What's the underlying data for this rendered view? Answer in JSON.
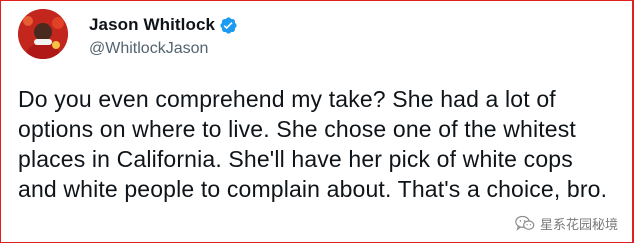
{
  "tweet": {
    "author_name": "Jason Whitlock",
    "author_handle": "@WhitlockJason",
    "verified_icon": "verified-badge-icon",
    "text": "Do you even comprehend my take? She had a lot of options on where to live. She chose one of the whitest places in California. She'll have her pick of white cops and white people to complain about. That's a choice, bro."
  },
  "watermark": {
    "icon": "wechat-icon",
    "text": "星系花园秘境"
  },
  "colors": {
    "frame_border": "#e02020",
    "verified_blue": "#1d9bf0",
    "handle_gray": "#536471",
    "text_dark": "#0f1419"
  }
}
